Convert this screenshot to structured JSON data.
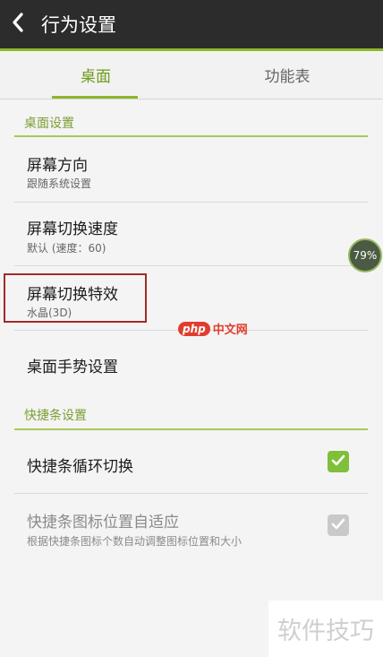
{
  "header": {
    "title": "行为设置",
    "back_icon": "chevron-left-icon"
  },
  "tabs": [
    {
      "label": "桌面",
      "active": true
    },
    {
      "label": "功能表",
      "active": false
    }
  ],
  "sections": [
    {
      "header": "桌面设置",
      "rows": [
        {
          "title": "屏幕方向",
          "sub": "跟随系统设置"
        },
        {
          "title": "屏幕切换速度",
          "sub": "默认 (速度：60)"
        },
        {
          "title": "屏幕切换特效",
          "sub": "水晶(3D)"
        },
        {
          "title": "桌面手势设置"
        }
      ]
    },
    {
      "header": "快捷条设置",
      "rows": [
        {
          "title": "快捷条循环切换",
          "checked": true
        },
        {
          "title": "快捷条图标位置自适应",
          "sub": "根据快捷条图标个数自动调整图标位置和大小",
          "checked": true,
          "disabled": true
        }
      ]
    }
  ],
  "badge": {
    "text": "79%"
  },
  "watermarks": {
    "php_logo": "php",
    "php_text": "中文网",
    "corner": "软件技巧"
  },
  "colors": {
    "accent": "#8cb72b",
    "topbar": "#2c2c2c",
    "highlight": "#a12b2b"
  }
}
